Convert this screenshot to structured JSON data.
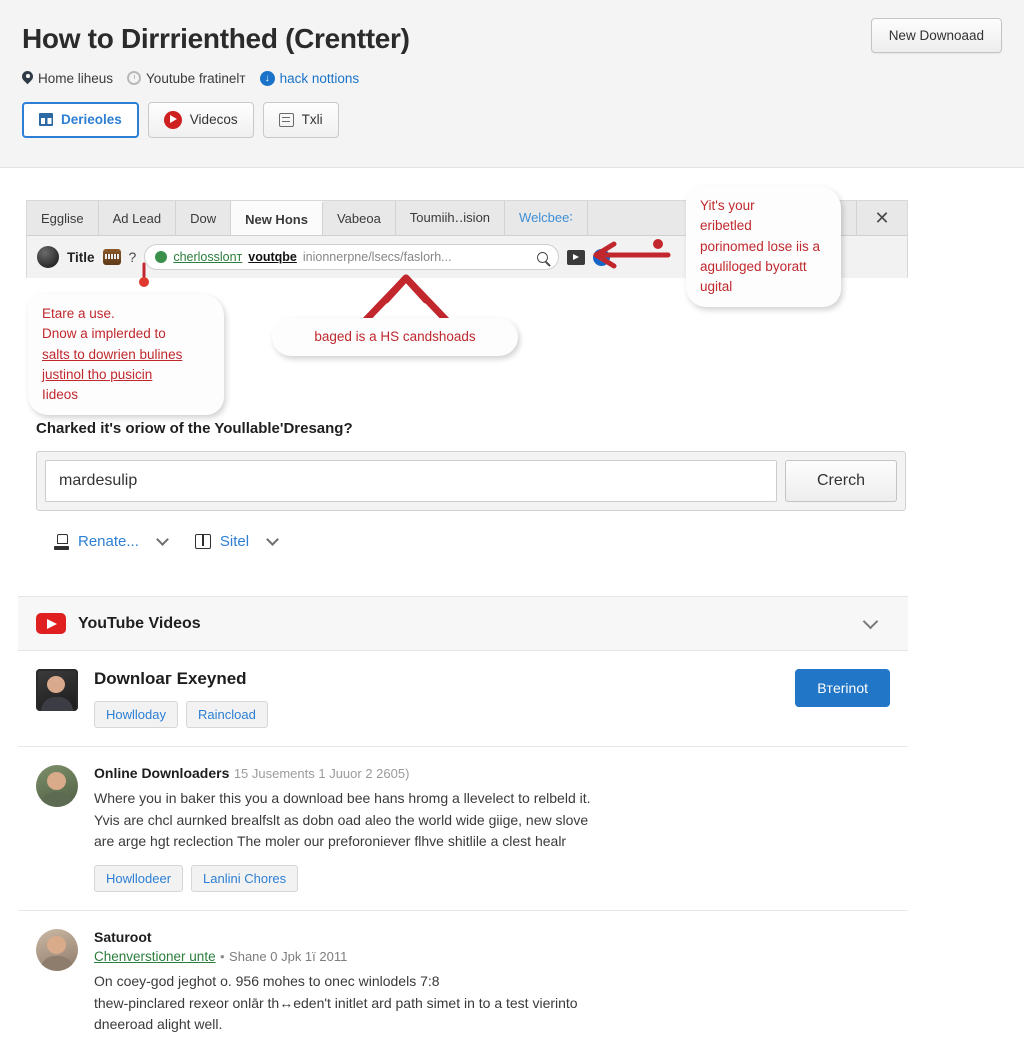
{
  "header": {
    "title": "How to Dirrrienthed (Crentter)",
    "new_download_label": "New Downoaad",
    "meta": [
      {
        "label": "Home liheus",
        "icon": "pin-icon"
      },
      {
        "label": "Youtube fratinelт",
        "icon": "clock-icon"
      },
      {
        "label": "hack nottions",
        "icon": "download-circle-icon"
      }
    ],
    "tabs": [
      {
        "label": "Derieoles",
        "icon": "grid-icon",
        "active": true
      },
      {
        "label": "Videcos",
        "icon": "youtube-icon",
        "active": false
      },
      {
        "label": "Tхlі",
        "icon": "txt-icon",
        "active": false
      }
    ]
  },
  "browser": {
    "tabs": [
      {
        "label": "Egglise"
      },
      {
        "label": "Ad Lead"
      },
      {
        "label": "Dow"
      },
      {
        "label": "New Honѕ",
        "active": true
      },
      {
        "label": "Vabeoa"
      },
      {
        "label": "Toumiіh․․ision"
      },
      {
        "label": "Welcbee∶",
        "link": true
      }
    ],
    "close_label": "✕",
    "address": {
      "title": "Title",
      "question_mark": "?",
      "url_secure": "cherlosslonт",
      "url_bold": "voutqbe",
      "url_path": "inionnerpne/lsecs/faslorh...",
      "search_icon": "magnifier-icon",
      "video_icon": "video-icon",
      "info_icon": "info-icon"
    }
  },
  "annotations": {
    "left": [
      "Etare a use.",
      "Dnow a implerded to",
      "salts to dowrien bulines",
      "justinol tho pusicin",
      "Iideos"
    ],
    "middle": "baged is a HS candshoads",
    "right": [
      "Yit's your",
      "eribetled",
      "porinomed lose iis a",
      "aguliloged byoratt",
      "ugital"
    ]
  },
  "search": {
    "label": "Charked it's oriow of the Youllable'Dresang?",
    "value": "mardesulip",
    "placeholder": "mardesulip",
    "button_label": "Crerch"
  },
  "filters": [
    {
      "label": "Renate...",
      "icon": "stamp-icon"
    },
    {
      "label": "Sitel",
      "icon": "book-icon"
    }
  ],
  "results_section": {
    "heading": "YouTube Videos",
    "logo_icon": "youtube-play-icon",
    "collapse_icon": "chevron-down-icon"
  },
  "results": [
    {
      "type": "featured",
      "title": "Downloaг Exeyned",
      "pills": [
        "Howlloday",
        "Raincload"
      ],
      "action_label": "Bтerinot",
      "avatar": "thumbnail-square"
    },
    {
      "type": "comment",
      "title": "Online Downloaders",
      "meta": "15 Jusements 1 Juuor 2 2605)",
      "lines": [
        "Where you in baker this you a download bee hans hromg a llevelect to relbeld it.",
        "Yvis are chcl aurnked brealfslt as dobn oad aleo the world wide giige, new slove",
        "are arge hgt reclection The moler our preforoniever flhve shitlile a clest healr"
      ],
      "pills": [
        "Howllodeer",
        "Lanlini Chores"
      ],
      "avatar": "avatar-round"
    },
    {
      "type": "comment",
      "title": "Saturoot",
      "link": "Chenverstioner unte",
      "separator": "•",
      "date": "Shane 0 Jpk 1ї 2011",
      "lines": [
        "On coey-god jeghot o. 956 mohes to onec winlodels 7:8",
        "thew-pinclared rexeor onlār th↔eden't initlet ard path simet in to a test vierinto",
        "dneeroad alight well."
      ],
      "avatar": "avatar-round-tan"
    }
  ],
  "colors": {
    "accent_blue": "#2176c7",
    "link_blue": "#2d7fd3",
    "annotation_red": "#c0282d",
    "youtube_red": "#e02020",
    "header_bg": "#f4f4f4"
  }
}
